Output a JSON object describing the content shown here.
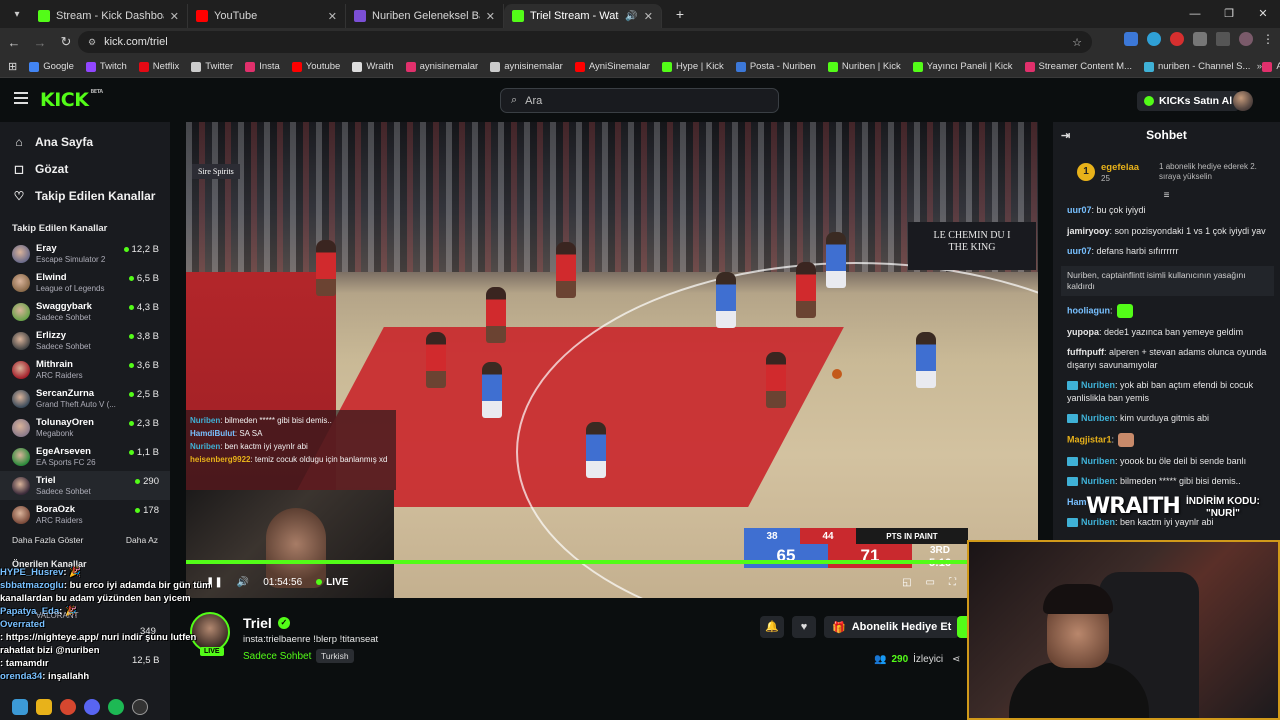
{
  "browser": {
    "tabs": [
      {
        "label": "Stream - Kick Dashboard",
        "color": "#53fc18",
        "active": false
      },
      {
        "label": "YouTube",
        "color": "#ff0000",
        "active": false
      },
      {
        "label": "Nuriben Geleneksel Ban Kaldırm",
        "color": "#7b4fd6",
        "active": false
      },
      {
        "label": "Triel Stream - Watch Live on",
        "color": "#53fc18",
        "active": true
      }
    ],
    "url": "kick.com/triel",
    "bookmarks": [
      {
        "label": "Google",
        "color": "#4285f4"
      },
      {
        "label": "Twitch",
        "color": "#9146ff"
      },
      {
        "label": "Netflix",
        "color": "#e50914"
      },
      {
        "label": "Twitter",
        "color": "#cccccc"
      },
      {
        "label": "Insta",
        "color": "#e1306c"
      },
      {
        "label": "Youtube",
        "color": "#ff0000"
      },
      {
        "label": "Wraith",
        "color": "#dddddd"
      },
      {
        "label": "aynisinemalar",
        "color": "#e1306c"
      },
      {
        "label": "aynisinemalar",
        "color": "#cccccc"
      },
      {
        "label": "AyniSinemalar",
        "color": "#ff0000"
      },
      {
        "label": "Hype | Kick",
        "color": "#53fc18"
      },
      {
        "label": "Posta - Nuriben",
        "color": "#3c78d8"
      },
      {
        "label": "Nuriben | Kick",
        "color": "#53fc18"
      },
      {
        "label": "Yayıncı Paneli | Kick",
        "color": "#53fc18"
      },
      {
        "label": "Streamer Content M...",
        "color": "#e1306c"
      },
      {
        "label": "nuriben - Channel S...",
        "color": "#3fb1d6"
      },
      {
        "label": "Aynı Sinemalar - Ça...",
        "color": "#e1306c"
      }
    ]
  },
  "header": {
    "logo": "KICK",
    "logo_badge": "BETA",
    "search_placeholder": "Ara",
    "kicks_button": "KICKs Satın Al"
  },
  "sidebar": {
    "nav": [
      {
        "label": "Ana Sayfa",
        "icon": "⌂"
      },
      {
        "label": "Gözat",
        "icon": "◻"
      },
      {
        "label": "Takip Edilen Kanallar",
        "icon": "♡"
      }
    ],
    "followed_title": "Takip Edilen Kanallar",
    "followed": [
      {
        "name": "Eray",
        "category": "Escape Simulator 2",
        "viewers": "12,2 B",
        "color": "#6b6b8a"
      },
      {
        "name": "Elwind",
        "category": "League of Legends",
        "viewers": "6,5 B",
        "color": "#8a6a4a"
      },
      {
        "name": "Swaggybark",
        "category": "Sadece Sohbet",
        "viewers": "4,3 B",
        "color": "#6aa24a"
      },
      {
        "name": "Erlizzy",
        "category": "Sadece Sohbet",
        "viewers": "3,8 B",
        "color": "#444"
      },
      {
        "name": "Mithrain",
        "category": "ARC Raiders",
        "viewers": "3,6 B",
        "color": "#a21e2a"
      },
      {
        "name": "SercanZurna",
        "category": "Grand Theft Auto V (...",
        "viewers": "2,5 B",
        "color": "#3a4a5a"
      },
      {
        "name": "TolunayOren",
        "category": "Megabonk",
        "viewers": "2,3 B",
        "color": "#8a7a8a"
      },
      {
        "name": "EgeArseven",
        "category": "EA Sports FC 26",
        "viewers": "1,1 B",
        "color": "#2a8a3a"
      },
      {
        "name": "Triel",
        "category": "Sadece Sohbet",
        "viewers": "290",
        "color": "#3a2a3a"
      },
      {
        "name": "BoraOzk",
        "category": "ARC Raiders",
        "viewers": "178",
        "color": "#7a4a3a"
      }
    ],
    "show_more": "Daha Fazla Göster",
    "show_less": "Daha Az",
    "recommended_title": "Önerilen Kanallar"
  },
  "video": {
    "board_text": [
      "LE CHEMIN DU I",
      "THE KING"
    ],
    "sponsor": "Sire Spirits",
    "overlay_chat": [
      {
        "user": "Nuriben",
        "text": ": bilmeden ***** gibi bisi demis..",
        "color": "#3fb1d6"
      },
      {
        "user": "HamdiBulut",
        "text": ": SA SA",
        "color": "#78c0ff"
      },
      {
        "user": "Nuriben",
        "text": ": ben kactm iyi yaynlr abi",
        "color": "#3fb1d6"
      },
      {
        "user": "heisenberg9922",
        "text": ": temiz cocuk oldugu için banlanmış xd",
        "color": "#e8b21a"
      }
    ],
    "score": {
      "team1_stat": "38",
      "team2_stat": "44",
      "stat_label": "PTS IN PAINT",
      "team1_score": "65",
      "team2_score": "71",
      "quarter": "3RD",
      "clock": "5:16",
      "team1_color": "#3f6fd1",
      "team2_color": "#c9292e"
    },
    "elapsed": "01:54:56",
    "live_label": "LIVE",
    "progress": 1.0
  },
  "stream": {
    "name": "Triel",
    "title": "insta:trielbaenre !blerp !titanseat",
    "category": "Sadece Sohbet",
    "language": "Turkish",
    "live_tag": "LIVE",
    "gift_button": "Abonelik Hediye Et",
    "viewers": "290",
    "viewers_label": "İzleyici"
  },
  "chat": {
    "title": "Sohbet",
    "pinned": {
      "rank": "1",
      "user": "egefelaa",
      "count": "25",
      "message": "1 abonelik hediye ederek 2. sıraya yükselin"
    },
    "messages": [
      {
        "type": "msg",
        "user": "uur07",
        "text": ": bu çok iyiydi",
        "color": "#78c0ff"
      },
      {
        "type": "msg",
        "user": "jamiryooy",
        "text": ": son pozisyondaki 1 vs 1 çok iyiydi yav",
        "color": "#e6e6e6"
      },
      {
        "type": "msg",
        "user": "uur07",
        "text": ": defans harbi sıfırrrrrr",
        "color": "#78c0ff"
      },
      {
        "type": "sys",
        "text": "Nuriben, captainflintt isimli kullanıcının yasağını kaldırdı"
      },
      {
        "type": "msg",
        "user": "hooliagun",
        "text": ":",
        "color": "#78c0ff",
        "emote": "#53fc18"
      },
      {
        "type": "msg",
        "user": "yupopa",
        "text": ": dede1 yazınca ban yemeye geldim",
        "color": "#e6e6e6"
      },
      {
        "type": "msg",
        "user": "fuffnpuff",
        "text": ": alperen + stevan adams olunca oyunda dışarıyı savunamıyolar",
        "color": "#e6e6e6"
      },
      {
        "type": "msg",
        "user": "Nuriben",
        "text": ": yok abi ban açtım efendi bi cocuk yanlislikla ban yemis",
        "color": "#3fb1d6",
        "badge": true
      },
      {
        "type": "msg",
        "user": "Nuriben",
        "text": ": kim vurduya gitmis abi",
        "color": "#3fb1d6",
        "badge": true
      },
      {
        "type": "msg",
        "user": "Magjistar1",
        "text": ":",
        "color": "#e8b21a",
        "emote": "#c88a6a"
      },
      {
        "type": "msg",
        "user": "Nuriben",
        "text": ": yoook bu öle deil bi sende banlı",
        "color": "#3fb1d6",
        "badge": true
      },
      {
        "type": "msg",
        "user": "Nuriben",
        "text": ": bilmeden ***** gibi bisi demis..",
        "color": "#3fb1d6",
        "badge": true
      },
      {
        "type": "msg",
        "user": "Ham",
        "text": "",
        "color": "#78c0ff"
      },
      {
        "type": "msg",
        "user": "Nuriben",
        "text": ": ben kactm iyi yaynlr abi",
        "color": "#3fb1d6",
        "badge": true
      }
    ]
  },
  "facecam": {
    "brand": "WRAITH",
    "promo_label": "İNDİRİM KODU:",
    "promo_code": "\"NURİ\""
  },
  "stream_overlay_chat": [
    {
      "user": "HYPE_Husrev",
      "text": ": 🎉"
    },
    {
      "user": "sbbatmazoglu",
      "text": ": bu erco iyi adamda bir gün tüm"
    },
    {
      "user": "",
      "text": "kanallardan bu adam yüzünden ban yicem"
    },
    {
      "user": "Papatya_Eda",
      "text": ": 🎉"
    },
    {
      "user": "Overrated",
      "text": ""
    },
    {
      "user": "",
      "text": ": https://nighteye.app/ nuri indir şunu lutfen"
    },
    {
      "user": "",
      "text": "rahatlat bizi @nuriben"
    },
    {
      "user": "",
      "text": ": tamamdır"
    },
    {
      "user": "orenda34",
      "text": ": inşallahh"
    }
  ],
  "overlay_extra": {
    "valorant": "VALORANT",
    "num1": "349",
    "num2": "12,5 B"
  }
}
